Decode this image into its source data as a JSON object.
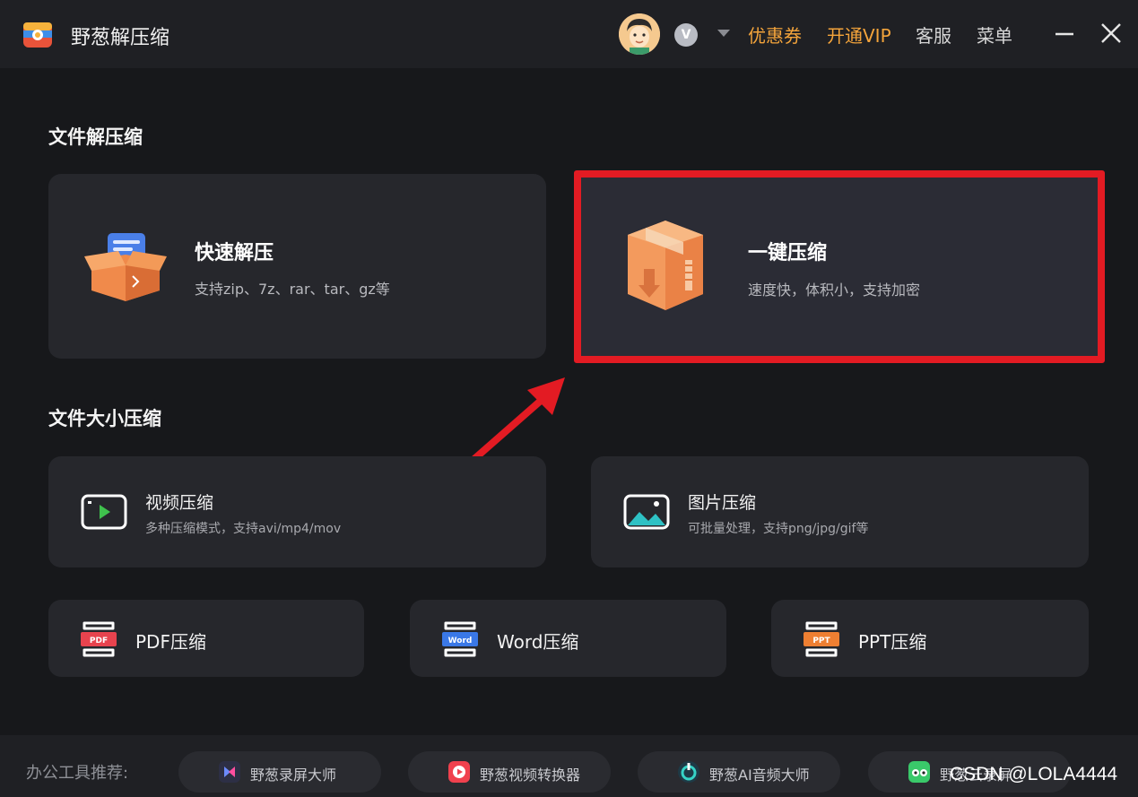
{
  "titlebar": {
    "app_title": "野葱解压缩",
    "vip_badge": "V",
    "coupon": "优惠券",
    "vip": "开通VIP",
    "service": "客服",
    "menu": "菜单"
  },
  "sections": {
    "decompress_title": "文件解压缩",
    "size_title": "文件大小压缩"
  },
  "cards": {
    "quick_extract": {
      "title": "快速解压",
      "subtitle": "支持zip、7z、rar、tar、gz等"
    },
    "one_click": {
      "title": "一键压缩",
      "subtitle": "速度快，体积小，支持加密"
    },
    "video": {
      "title": "视频压缩",
      "subtitle": "多种压缩模式，支持avi/mp4/mov"
    },
    "image": {
      "title": "图片压缩",
      "subtitle": "可批量处理，支持png/jpg/gif等"
    },
    "pdf": {
      "title": "PDF压缩",
      "icon_text": "PDF"
    },
    "word": {
      "title": "Word压缩",
      "icon_text": "Word"
    },
    "ppt": {
      "title": "PPT压缩",
      "icon_text": "PPT"
    }
  },
  "bottombar": {
    "label": "办公工具推荐:",
    "tools": [
      {
        "label": "野葱录屏大师"
      },
      {
        "label": "野葱视频转换器"
      },
      {
        "label": "野葱AI音频大师"
      },
      {
        "label": "野葱云录屏"
      }
    ]
  },
  "watermark": "CSDN @LOLA4444",
  "colors": {
    "background": "#17181b",
    "card": "#26272c",
    "accent_orange": "#f4a43b",
    "highlight_red": "#e31b23"
  }
}
